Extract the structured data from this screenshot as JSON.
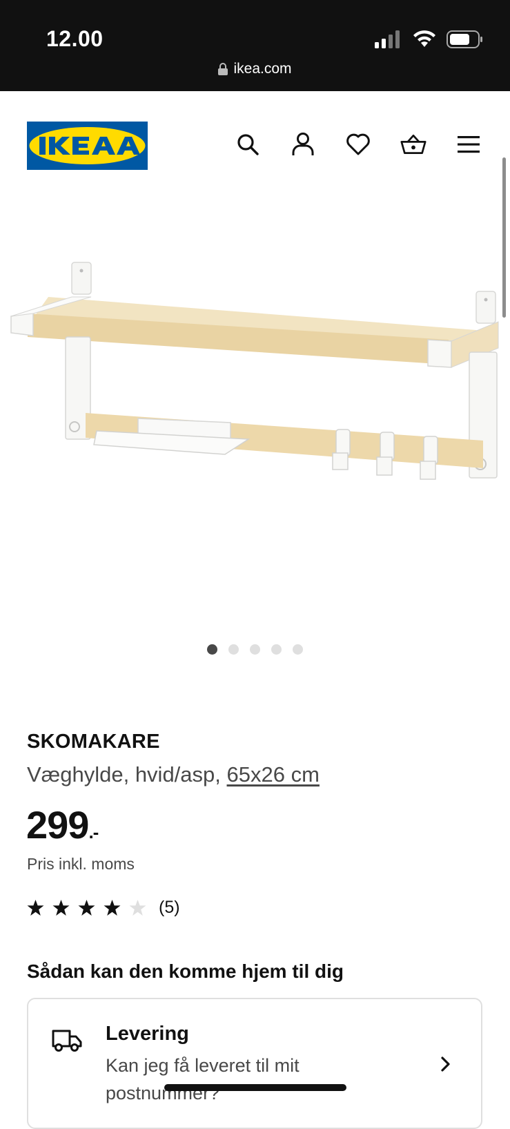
{
  "status_bar": {
    "time": "12.00",
    "url": "ikea.com",
    "icons": [
      "signal-icon",
      "wifi-icon",
      "battery-icon"
    ]
  },
  "header": {
    "logo_text": "IKEA",
    "icons": [
      "search-icon",
      "account-icon",
      "heart-icon",
      "basket-icon",
      "menu-icon"
    ],
    "brand_colors": {
      "blue": "#0058a3",
      "yellow": "#ffdb00"
    }
  },
  "gallery": {
    "image": "wall-shelf-product-image",
    "image_count": 5,
    "active_index": 0
  },
  "product": {
    "name": "SKOMAKARE",
    "description_prefix": "Væghylde, hvid/asp,",
    "size": "65x26 cm",
    "price": "299",
    "price_suffix": ".-",
    "price_note": "Pris inkl. moms",
    "rating": 4,
    "rating_max": 5,
    "rating_count": "(5)"
  },
  "delivery_section": {
    "title": "Sådan kan den komme hjem til dig",
    "card_title": "Levering",
    "card_text": "Kan jeg få leveret til mit postnummer?"
  }
}
